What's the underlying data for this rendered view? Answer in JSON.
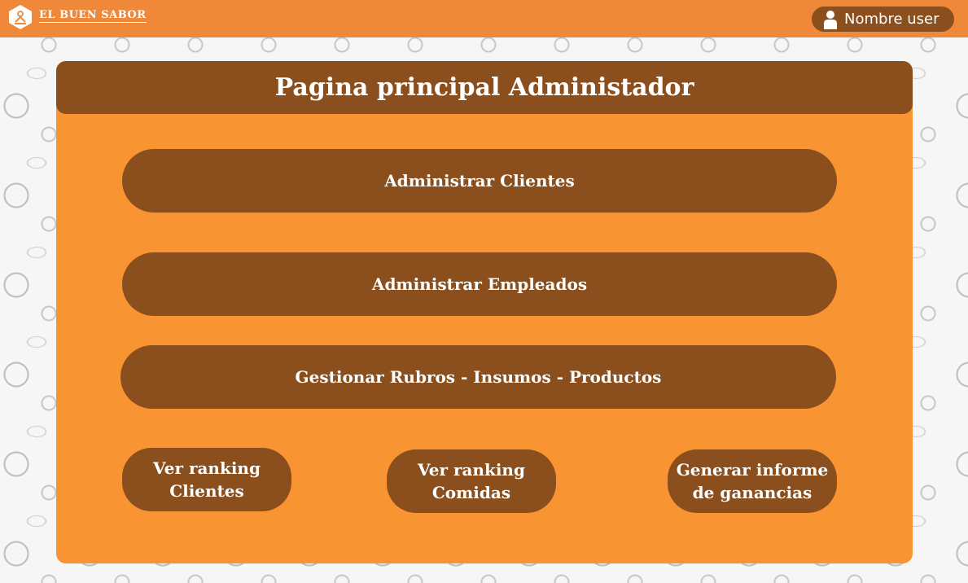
{
  "brand": {
    "name": "EL BUEN SABOR",
    "logo_icon": "chef-hat-logo-icon"
  },
  "user": {
    "icon": "user-icon",
    "name": "Nombre user"
  },
  "panel": {
    "title": "Pagina principal Administador"
  },
  "actions": {
    "clients": "Administrar Clientes",
    "employees": "Administrar  Empleados",
    "catalog": "Gestionar Rubros - Insumos - Productos",
    "ranking_clients": "Ver ranking\nClientes",
    "ranking_food": "Ver ranking\nComidas",
    "earnings_report": "Generar informe\nde ganancias"
  },
  "colors": {
    "topbar": "#f0883a",
    "panel": "#f99433",
    "button": "#8b4f1d",
    "text": "#ffffff"
  }
}
